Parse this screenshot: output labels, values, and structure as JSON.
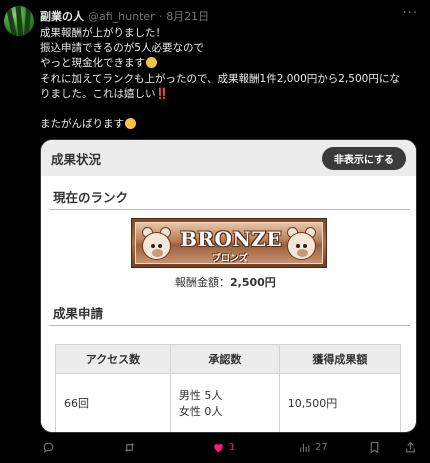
{
  "tweet": {
    "display_name": "副業の人",
    "handle": "@afi_hunter",
    "date": "8月21日",
    "more_icon": "more-dots-icon",
    "lines": [
      "成果報酬が上がりました！",
      "振込申請できるのが5人必要なので",
      "やっと現金化できます",
      "それに加えてランクも上がったので、成果報酬1件2,000円から2,500円にな",
      "りました。これは嬉しい"
    ],
    "bang": "‼️",
    "closing": "またがんばります"
  },
  "card": {
    "header_title": "成果状況",
    "hide_button": "非表示にする",
    "rank_title": "現在のランク",
    "badge_word": "BRONZE",
    "badge_sub": "ブロンズ",
    "reward_label": "報酬金額：",
    "reward_value": "2,500円",
    "apply_title": "成果申請",
    "table": {
      "headers": [
        "アクセス数",
        "承認数",
        "獲得成果額"
      ],
      "row": {
        "access": "66回",
        "approved_male": "男性 5人",
        "approved_female": "女性 0人",
        "amount": "10,500円"
      }
    }
  },
  "actions": {
    "reply_count": "",
    "retweet_count": "",
    "like_count": "1",
    "view_count": "27",
    "like_color": "#f91880",
    "icon_color": "#71767b"
  }
}
